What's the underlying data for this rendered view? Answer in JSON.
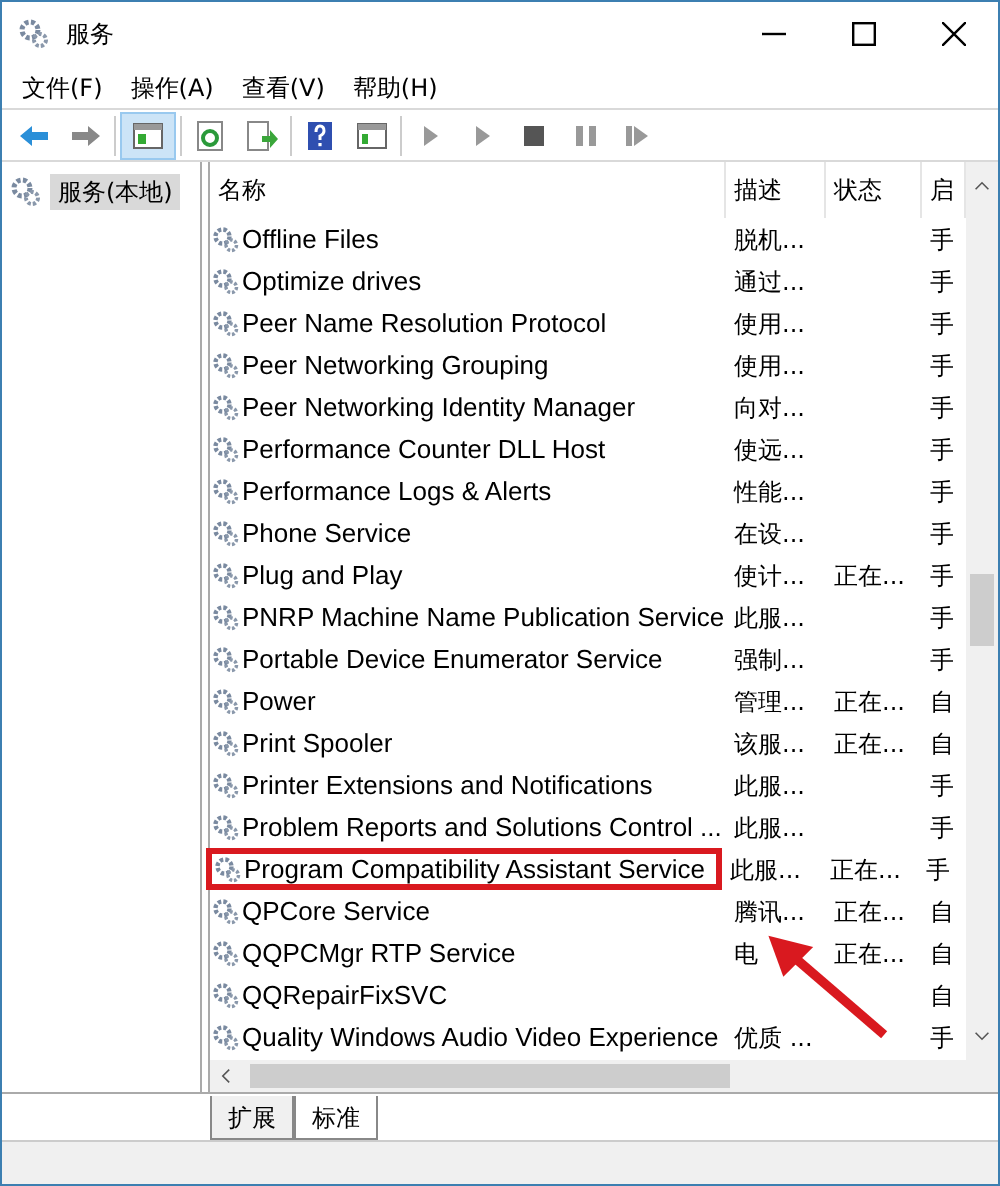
{
  "window": {
    "title": "服务"
  },
  "menu": [
    "文件(F)",
    "操作(A)",
    "查看(V)",
    "帮助(H)"
  ],
  "tree": [
    {
      "label": "服务(本地)",
      "selected": true
    }
  ],
  "table": {
    "columns": [
      "名称",
      "描述",
      "状态",
      "启"
    ],
    "rows": [
      {
        "name": "Offline Files",
        "description": "脱机...",
        "status": "",
        "startup": "手",
        "marked": false
      },
      {
        "name": "Optimize drives",
        "description": "通过...",
        "status": "",
        "startup": "手",
        "marked": false
      },
      {
        "name": "Peer Name Resolution Protocol",
        "description": "使用...",
        "status": "",
        "startup": "手",
        "marked": false
      },
      {
        "name": "Peer Networking Grouping",
        "description": "使用...",
        "status": "",
        "startup": "手",
        "marked": false
      },
      {
        "name": "Peer Networking Identity Manager",
        "description": "向对...",
        "status": "",
        "startup": "手",
        "marked": false
      },
      {
        "name": "Performance Counter DLL Host",
        "description": "使远...",
        "status": "",
        "startup": "手",
        "marked": false
      },
      {
        "name": "Performance Logs & Alerts",
        "description": "性能...",
        "status": "",
        "startup": "手",
        "marked": false
      },
      {
        "name": "Phone Service",
        "description": "在设...",
        "status": "",
        "startup": "手",
        "marked": false
      },
      {
        "name": "Plug and Play",
        "description": "使计...",
        "status": "正在...",
        "startup": "手",
        "marked": false
      },
      {
        "name": "PNRP Machine Name Publication Service",
        "description": "此服...",
        "status": "",
        "startup": "手",
        "marked": false
      },
      {
        "name": "Portable Device Enumerator Service",
        "description": "强制...",
        "status": "",
        "startup": "手",
        "marked": false
      },
      {
        "name": "Power",
        "description": "管理...",
        "status": "正在...",
        "startup": "自",
        "marked": false
      },
      {
        "name": "Print Spooler",
        "description": "该服...",
        "status": "正在...",
        "startup": "自",
        "marked": false
      },
      {
        "name": "Printer Extensions and Notifications",
        "description": "此服...",
        "status": "",
        "startup": "手",
        "marked": false
      },
      {
        "name": "Problem Reports and Solutions Control ...",
        "description": "此服...",
        "status": "",
        "startup": "手",
        "marked": false
      },
      {
        "name": "Program Compatibility Assistant Service",
        "description": "此服...",
        "status": "正在...",
        "startup": "手",
        "marked": true
      },
      {
        "name": "QPCore Service",
        "description": "腾讯...",
        "status": "正在...",
        "startup": "自",
        "marked": false
      },
      {
        "name": "QQPCMgr RTP Service",
        "description": "电",
        "status": "正在...",
        "startup": "自",
        "marked": false
      },
      {
        "name": "QQRepairFixSVC",
        "description": "",
        "status": "",
        "startup": "自",
        "marked": false
      },
      {
        "name": "Quality Windows Audio Video Experience",
        "description": "优质 ...",
        "status": "",
        "startup": "手",
        "marked": false
      }
    ]
  },
  "view_tabs": [
    {
      "label": "扩展",
      "selected": false
    },
    {
      "label": "标准",
      "selected": true
    }
  ]
}
